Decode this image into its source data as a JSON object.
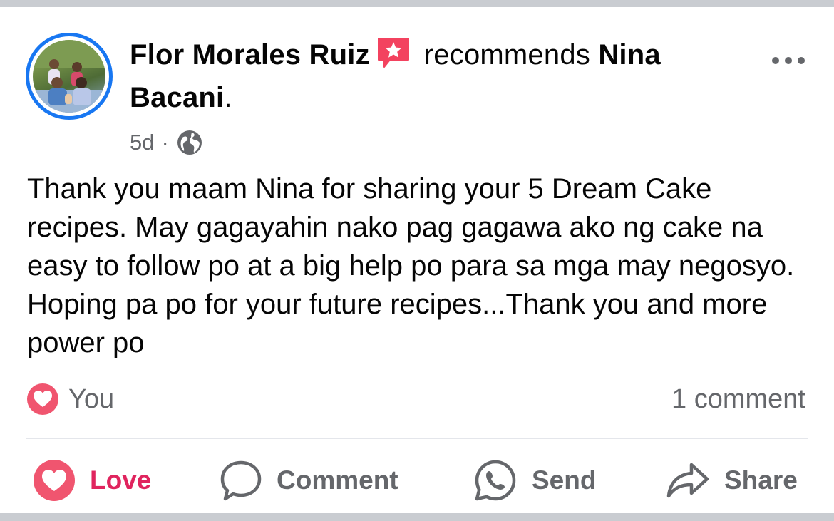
{
  "post": {
    "author": "Flor Morales Ruiz",
    "verb": "recommends",
    "target_first": "Nina",
    "target_last": "Bacani",
    "period": ".",
    "time": "5d",
    "dot": "·",
    "audience_icon": "globe-icon",
    "text": "Thank you maam Nina for sharing your 5 Dream Cake recipes. May gagayahin nako pag gagawa ako ng cake na easy to follow po at a big help po para sa mga may negosyo. Hoping pa po for your future recipes...Thank you and more power po"
  },
  "reactions": {
    "icon": "heart-icon",
    "label": "You",
    "comments": "1 comment"
  },
  "actions": {
    "love": "Love",
    "comment": "Comment",
    "send": "Send",
    "share": "Share"
  },
  "colors": {
    "accent": "#1877f2",
    "love": "#e0245e",
    "recommend_badge": "#f3425f",
    "secondary_text": "#65676b"
  }
}
